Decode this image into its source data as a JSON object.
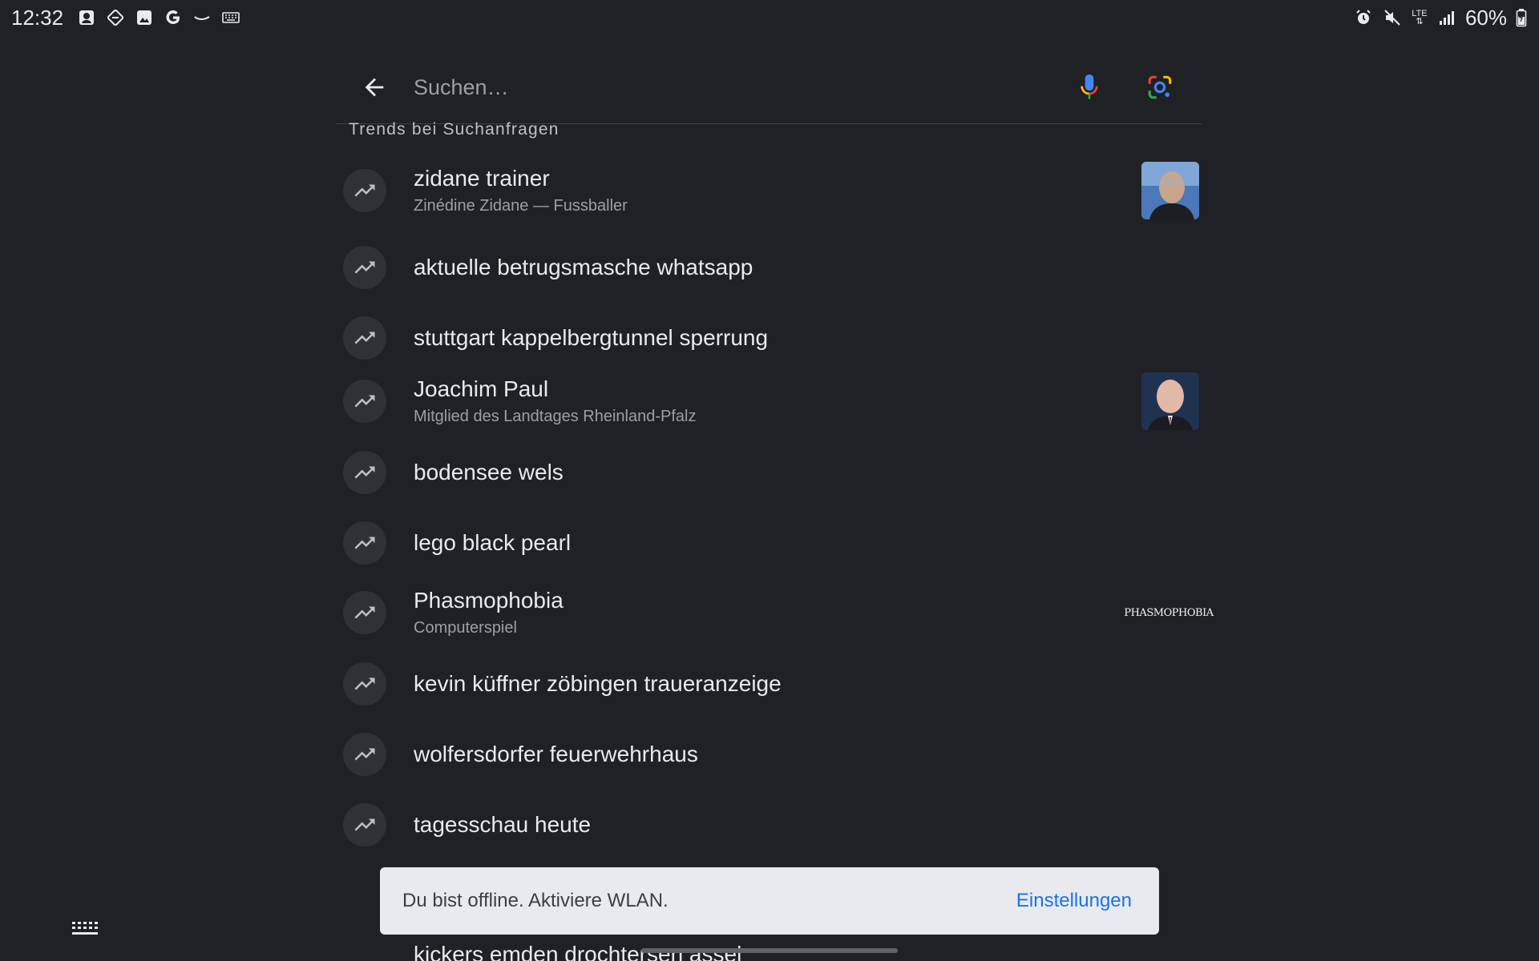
{
  "status_bar": {
    "time": "12:32",
    "battery": "60%",
    "network": "LTE",
    "left_icons": [
      "profile-icon",
      "rotate-icon",
      "gallery-icon",
      "google-icon",
      "wave-icon",
      "keyboard-icon"
    ],
    "right_icons": [
      "alarm-icon",
      "mute-icon",
      "lte-icon",
      "signal-icon",
      "battery-icon"
    ]
  },
  "search": {
    "placeholder": "Suchen…",
    "value": ""
  },
  "section_title": "Trends bei Suchanfragen",
  "trends": [
    {
      "title": "zidane trainer",
      "subtitle": "Zinédine Zidane — Fussballer",
      "thumb": "person-zidane"
    },
    {
      "title": "aktuelle betrugsmasche whatsapp",
      "subtitle": "",
      "thumb": ""
    },
    {
      "title": "stuttgart kappelbergtunnel sperrung",
      "subtitle": "",
      "thumb": ""
    },
    {
      "title": "Joachim Paul",
      "subtitle": "Mitglied des Landtages Rheinland-Pfalz",
      "thumb": "person-paul"
    },
    {
      "title": "bodensee wels",
      "subtitle": "",
      "thumb": ""
    },
    {
      "title": "lego black pearl",
      "subtitle": "",
      "thumb": ""
    },
    {
      "title": "Phasmophobia",
      "subtitle": "Computerspiel",
      "thumb": "logo-phasmophobia",
      "thumb_text": "PHASMOPHOBIA"
    },
    {
      "title": "kevin küffner zöbingen traueranzeige",
      "subtitle": "",
      "thumb": ""
    },
    {
      "title": "wolfersdorfer feuerwehrhaus",
      "subtitle": "",
      "thumb": ""
    },
    {
      "title": "tagesschau heute",
      "subtitle": "",
      "thumb": ""
    }
  ],
  "partial_item": "kickers emden drochtersen assel",
  "snackbar": {
    "message": "Du bist offline. Aktiviere WLAN.",
    "action": "Einstellungen"
  },
  "colors": {
    "background": "#202124",
    "text": "#e8eaed",
    "secondary_text": "#9aa0a6",
    "snackbar_bg": "#e8eaed",
    "snackbar_action": "#1a73e8"
  }
}
